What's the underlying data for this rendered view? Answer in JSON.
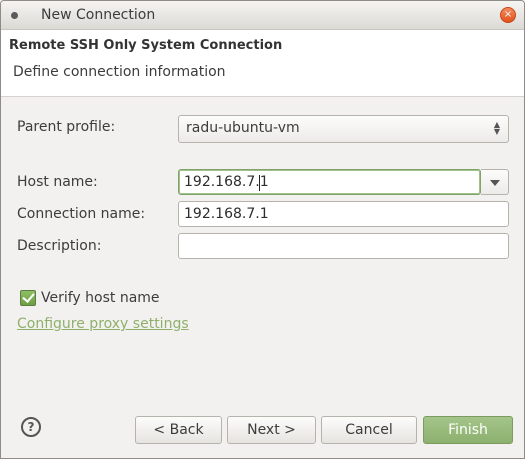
{
  "window": {
    "title": "New Connection",
    "close_glyph": "×"
  },
  "header": {
    "title": "Remote SSH Only System Connection",
    "description": "Define connection information"
  },
  "form": {
    "parent_profile_label": "Parent profile:",
    "parent_profile_value": "radu-ubuntu-vm",
    "host_name_label": "Host name:",
    "host_name_value": "192.168.7.1",
    "connection_name_label": "Connection name:",
    "connection_name_value": "192.168.7.1",
    "description_label": "Description:",
    "description_value": "",
    "verify_host_label": "Verify host name",
    "verify_host_checked": true,
    "proxy_link": "Configure proxy settings"
  },
  "buttons": {
    "help": "?",
    "back": "< Back",
    "next": "Next >",
    "cancel": "Cancel",
    "finish": "Finish"
  },
  "colors": {
    "accent_green": "#8cb06e",
    "link_green": "#8fb06b",
    "close_orange": "#e2521d"
  }
}
